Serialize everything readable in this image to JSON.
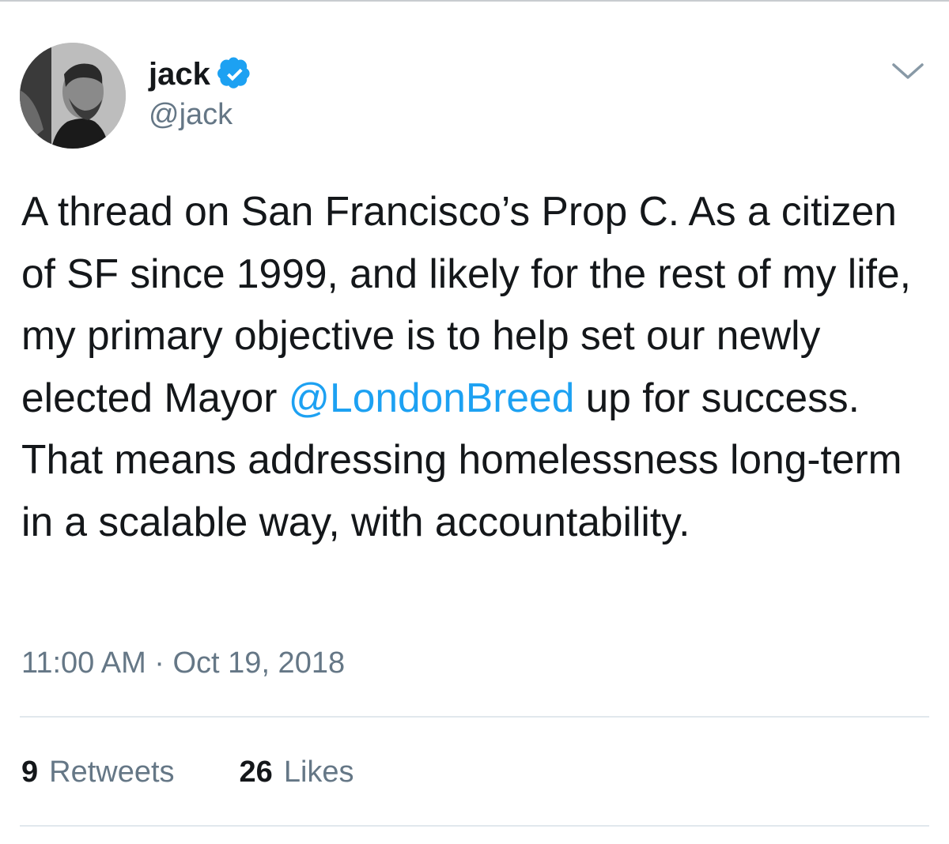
{
  "user": {
    "display_name": "jack",
    "handle": "@jack",
    "verified": true
  },
  "tweet": {
    "text_before_mention": "A thread on San Francisco’s Prop C. As a citizen of SF since 1999, and likely for the rest of my life, my primary objective is to help set our newly elected Mayor ",
    "mention": "@LondonBreed",
    "text_after_mention": " up for success. That means addressing homelessness long-term in a scalable way, with accountability.",
    "timestamp": "11:00 AM · Oct 19, 2018"
  },
  "stats": {
    "retweets_count": "9",
    "retweets_label": "Retweets",
    "likes_count": "26",
    "likes_label": "Likes"
  },
  "icons": {
    "verified": "verified-badge-icon",
    "menu": "chevron-down-icon"
  },
  "colors": {
    "text": "#14171a",
    "secondary": "#657786",
    "link": "#1da1f2",
    "verified": "#1da1f2",
    "divider": "#e1e8ed"
  }
}
